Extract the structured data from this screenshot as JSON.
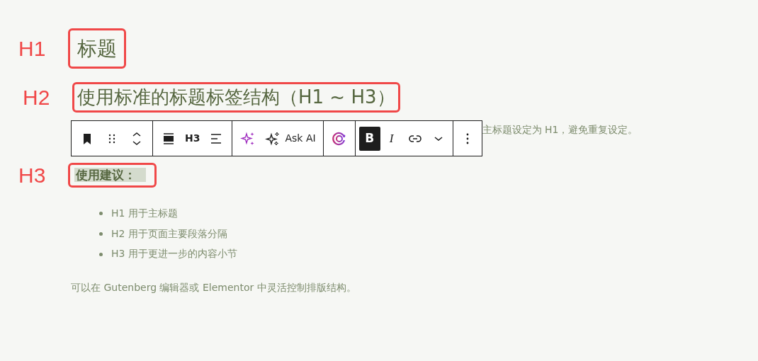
{
  "blocks": [
    {
      "kind": "h1",
      "annotation": "H1",
      "text": "标题"
    },
    {
      "kind": "h2",
      "annotation": "H2",
      "text": "使用标准的标题标签结构（H1 ~ H3）"
    },
    {
      "kind": "toolbar",
      "groups": [
        [
          {
            "kind": "bookmark"
          },
          {
            "kind": "drag"
          },
          {
            "kind": "move"
          }
        ],
        [
          {
            "kind": "align"
          },
          {
            "kind": "text",
            "label": "H3"
          },
          {
            "kind": "textalign"
          }
        ],
        [
          {
            "kind": "sparkle"
          },
          {
            "kind": "ask",
            "label": "Ask AI"
          }
        ],
        [
          {
            "kind": "ailogo"
          }
        ],
        [
          {
            "kind": "text",
            "label": "B",
            "active": true
          },
          {
            "kind": "italic",
            "label": "I"
          },
          {
            "kind": "link"
          },
          {
            "kind": "chevron"
          }
        ],
        [
          {
            "kind": "more"
          }
        ]
      ]
    },
    {
      "kind": "paragraph",
      "text": "主标题设定为 H1，避免重复设定。"
    },
    {
      "kind": "h3",
      "annotation": "H3",
      "text": "使用建议：",
      "selected": true
    },
    {
      "kind": "list",
      "items": [
        "H1 用于主标题",
        "H2 用于页面主要段落分隔",
        "H3 用于更进一步的内容小节"
      ]
    },
    {
      "kind": "paragraph",
      "text": "可以在 Gutenberg 编辑器或 Elementor 中灵活控制排版结构。"
    }
  ]
}
